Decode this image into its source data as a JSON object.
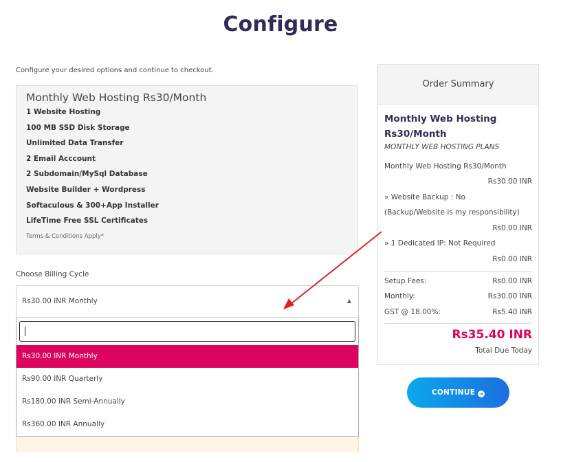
{
  "page": {
    "title": "Configure",
    "intro": "Configure your desired options and continue to checkout."
  },
  "product": {
    "name": "Monthly Web Hosting Rs30/Month",
    "features": [
      "1 Website Hosting",
      "100 MB SSD Disk Storage",
      "Unlimited Data Transfer",
      "2 Email Acccount",
      "2 Subdomain/MySql Database",
      "Website Builder + Wordpress",
      "Softaculous & 300+App Installer",
      "LifeTime Free SSL Certificates"
    ],
    "terms": "Terms & Conditions Apply*"
  },
  "billing": {
    "label": "Choose Billing Cycle",
    "selected": "Rs30.00 INR Monthly",
    "search_value": "",
    "options": [
      "Rs30.00 INR Monthly",
      "Rs90.00 INR Quarterly",
      "Rs180.00 INR Semi-Annually",
      "Rs360.00 INR Annually"
    ]
  },
  "summary": {
    "header": "Order Summary",
    "product_name": "Monthly Web Hosting Rs30/Month",
    "product_group": "MONTHLY WEB HOSTING PLANS",
    "line_item": "Monthly Web Hosting Rs30/Month",
    "line_item_price": "Rs30.00 INR",
    "addon1": "» Website Backup : No (Backup/Website is my responsibility)",
    "addon1_a": "» Website Backup : No",
    "addon1_b": "(Backup/Website is my responsibility)",
    "addon1_price": "Rs0.00 INR",
    "addon2": "» 1 Dedicated IP: Not Required",
    "addon2_price": "Rs0.00 INR",
    "setup_label": "Setup Fees:",
    "setup_value": "Rs0.00 INR",
    "monthly_label": "Monthly:",
    "monthly_value": "Rs30.00 INR",
    "gst_label": "GST @ 18.00%:",
    "gst_value": "Rs5.40 INR",
    "total": "Rs35.40 INR",
    "total_label": "Total Due Today"
  },
  "actions": {
    "continue_label": "CONTINUE"
  },
  "icons": {
    "continue": "arrow-circle-right-icon",
    "select": "caret-up-icon"
  },
  "colors": {
    "accent": "#dd0460",
    "title": "#2e2d58",
    "button_start": "#0aa8ec",
    "button_end": "#1d6fe0",
    "annotation": "#e02020"
  }
}
